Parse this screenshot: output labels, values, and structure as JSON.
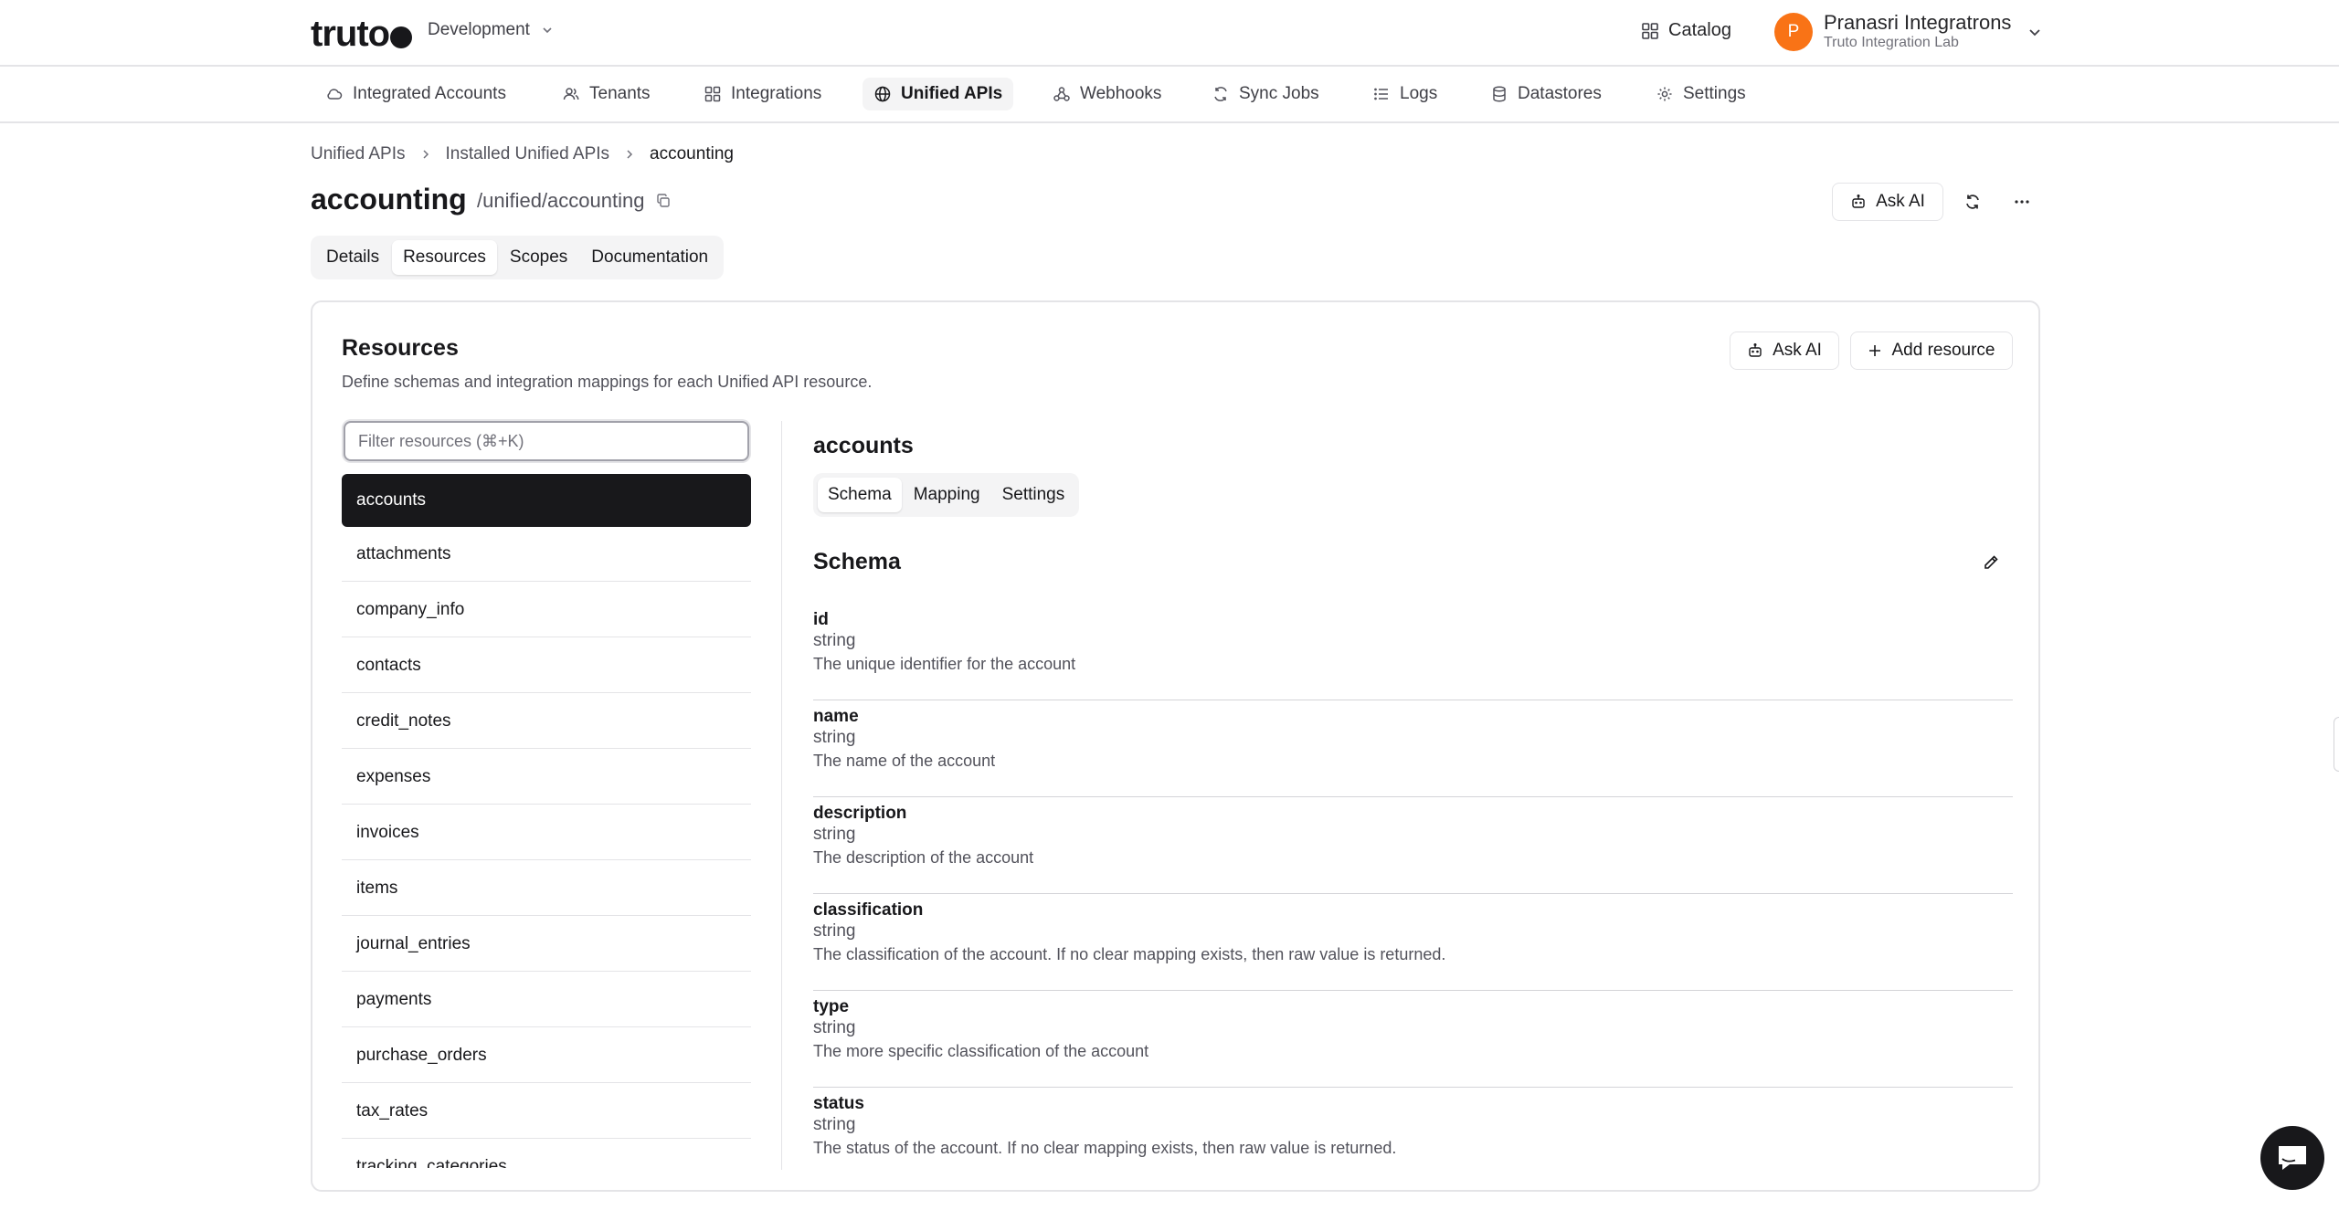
{
  "header": {
    "logo_text": "truto",
    "environment": "Development",
    "catalog_label": "Catalog",
    "user": {
      "initial": "P",
      "name": "Pranasri Integratrons",
      "org": "Truto Integration Lab"
    }
  },
  "nav": {
    "items": [
      {
        "label": "Integrated Accounts",
        "icon": "cloud-icon"
      },
      {
        "label": "Tenants",
        "icon": "users-icon"
      },
      {
        "label": "Integrations",
        "icon": "grid-icon"
      },
      {
        "label": "Unified APIs",
        "icon": "globe-icon",
        "active": true
      },
      {
        "label": "Webhooks",
        "icon": "webhook-icon"
      },
      {
        "label": "Sync Jobs",
        "icon": "sync-icon"
      },
      {
        "label": "Logs",
        "icon": "list-icon"
      },
      {
        "label": "Datastores",
        "icon": "database-icon"
      },
      {
        "label": "Settings",
        "icon": "gear-icon"
      }
    ]
  },
  "breadcrumb": {
    "items": [
      "Unified APIs",
      "Installed Unified APIs",
      "accounting"
    ]
  },
  "page": {
    "title": "accounting",
    "path": "/unified/accounting",
    "ask_ai_label": "Ask AI",
    "tabs": [
      "Details",
      "Resources",
      "Scopes",
      "Documentation"
    ],
    "active_tab": "Resources"
  },
  "resources_card": {
    "title": "Resources",
    "description": "Define schemas and integration mappings for each Unified API resource.",
    "ask_ai_label": "Ask AI",
    "add_label": "Add resource",
    "filter_placeholder": "Filter resources (⌘+K)",
    "items": [
      "accounts",
      "attachments",
      "company_info",
      "contacts",
      "credit_notes",
      "expenses",
      "invoices",
      "items",
      "journal_entries",
      "payments",
      "purchase_orders",
      "tax_rates",
      "tracking_categories"
    ],
    "active_item": "accounts"
  },
  "detail": {
    "title": "accounts",
    "tabs": [
      "Schema",
      "Mapping",
      "Settings"
    ],
    "active_tab": "Schema",
    "schema_heading": "Schema",
    "fields": [
      {
        "name": "id",
        "type": "string",
        "description": "The unique identifier for the account"
      },
      {
        "name": "name",
        "type": "string",
        "description": "The name of the account"
      },
      {
        "name": "description",
        "type": "string",
        "description": "The description of the account"
      },
      {
        "name": "classification",
        "type": "string",
        "description": "The classification of the account. If no clear mapping exists, then raw value is returned."
      },
      {
        "name": "type",
        "type": "string",
        "description": "The more specific classification of the account"
      },
      {
        "name": "status",
        "type": "string",
        "description": "The status of the account. If no clear mapping exists, then raw value is returned."
      }
    ]
  },
  "colors": {
    "accent": "#18181b",
    "avatar": "#f97316",
    "border": "#e4e4e7"
  }
}
